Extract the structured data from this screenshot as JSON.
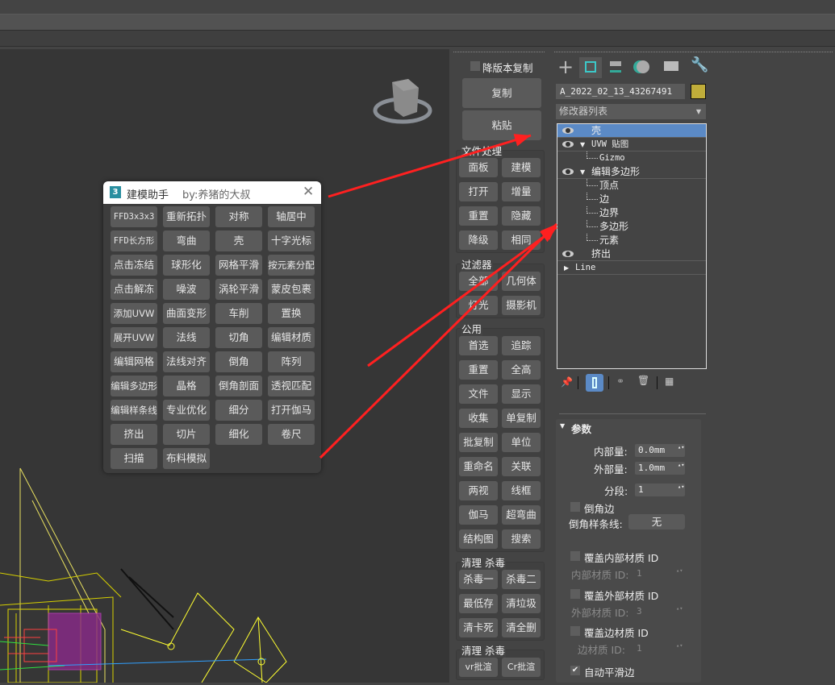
{
  "dialog": {
    "title": "建模助手",
    "author": "by:养猪的大叔",
    "buttons": [
      "FFD3x3x3",
      "重新拓扑",
      "对称",
      "轴居中",
      "FFD长方形",
      "弯曲",
      "壳",
      "十字光标",
      "点击冻结",
      "球形化",
      "网格平滑",
      "按元素分配",
      "点击解冻",
      "噪波",
      "涡轮平滑",
      "蒙皮包裹",
      "添加UVW",
      "曲面变形",
      "车削",
      "置换",
      "展开UVW",
      "法线",
      "切角",
      "编辑材质",
      "编辑网格",
      "法线对齐",
      "倒角",
      "阵列",
      "编辑多边形",
      "晶格",
      "倒角剖面",
      "透视匹配",
      "编辑样条线",
      "专业优化",
      "细分",
      "打开伽马",
      "挤出",
      "切片",
      "细化",
      "卷尺",
      "扫描",
      "布料模拟"
    ]
  },
  "script_panel": {
    "downgrade_copy_label": "降版本复制",
    "copy": "复制",
    "paste": "粘贴",
    "groups": [
      {
        "label": "文件处理",
        "buttons": [
          "面板",
          "建模",
          "打开",
          "增量",
          "重置",
          "隐藏",
          "降级",
          "相同"
        ]
      },
      {
        "label": "过滤器",
        "buttons": [
          "全部",
          "几何体",
          "灯光",
          "摄影机"
        ]
      },
      {
        "label": "公用",
        "buttons": [
          "首选",
          "追踪",
          "重置",
          "全高",
          "文件",
          "显示",
          "收集",
          "单复制",
          "批复制",
          "单位",
          "重命名",
          "关联",
          "两视",
          "线框",
          "伽马",
          "超弯曲",
          "结构图",
          "搜索"
        ]
      },
      {
        "label": "清理 杀毒",
        "buttons": [
          "杀毒一",
          "杀毒二",
          "最低存",
          "清垃圾",
          "清卡死",
          "清全删"
        ]
      },
      {
        "label": "清理 杀毒",
        "buttons": [
          "vr批渲",
          "Cr批渲"
        ]
      }
    ]
  },
  "command_panel": {
    "object_name": "A_2022_02_13_43267491",
    "object_color": "#c0ad3a",
    "modifier_list": "修改器列表",
    "stack": [
      {
        "label": "壳",
        "eye": true,
        "selected": true,
        "level": 0
      },
      {
        "label": "UVW 贴图",
        "eye": true,
        "expand": "▼",
        "level": 0
      },
      {
        "label": "Gizmo",
        "level": 1
      },
      {
        "label": "编辑多边形",
        "eye": true,
        "expand": "▼",
        "level": 0
      },
      {
        "label": "顶点",
        "level": 1
      },
      {
        "label": "边",
        "level": 1
      },
      {
        "label": "边界",
        "level": 1
      },
      {
        "label": "多边形",
        "level": 1
      },
      {
        "label": "元素",
        "level": 1
      },
      {
        "label": "挤出",
        "eye": true,
        "level": 0
      },
      {
        "label": "Line",
        "expand": "▶",
        "level": 0
      }
    ],
    "params": {
      "title": "参数",
      "inner_label": "内部量:",
      "inner_value": "0.0mm",
      "outer_label": "外部量:",
      "outer_value": "1.0mm",
      "segments_label": "分段:",
      "segments_value": "1",
      "bevel_edges": "倒角边",
      "bevel_spline_label": "倒角样条线:",
      "bevel_spline_value": "无",
      "override_inner": "覆盖内部材质 ID",
      "inner_mat_label": "内部材质 ID:",
      "inner_mat_value": "1",
      "override_outer": "覆盖外部材质 ID",
      "outer_mat_label": "外部材质 ID:",
      "outer_mat_value": "3",
      "override_edge": "覆盖边材质 ID",
      "edge_mat_label": "边材质 ID:",
      "edge_mat_value": "1",
      "auto_smooth": "自动平滑边"
    }
  },
  "colors": {
    "accent": "#5b8ac6",
    "arrow": "#ff2020"
  }
}
